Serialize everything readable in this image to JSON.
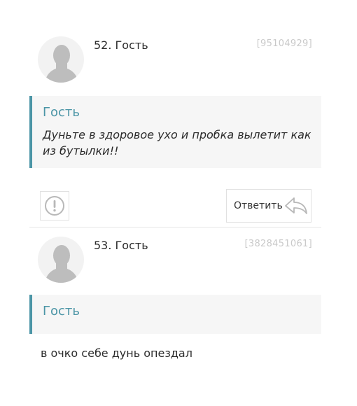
{
  "comments": [
    {
      "author": "52. Гость",
      "id": "[95104929]",
      "quote_author": "Гость",
      "quote_text": "Дуньте в здоровое ухо и пробка вылетит как из бутылки!!"
    },
    {
      "author": "53. Гость",
      "id": "[3828451061]",
      "quote_author": "Гость",
      "text": "в очко себе дунь опездал"
    }
  ],
  "actions": {
    "reply_label": "Ответить",
    "report_icon": "exclamation-circle-icon",
    "reply_icon": "reply-arrow-icon"
  },
  "colors": {
    "accent": "#4b95a6",
    "quote_bg": "#f6f6f6",
    "id_gray": "#c9c9c9",
    "avatar_bg": "#f2f2f2"
  }
}
